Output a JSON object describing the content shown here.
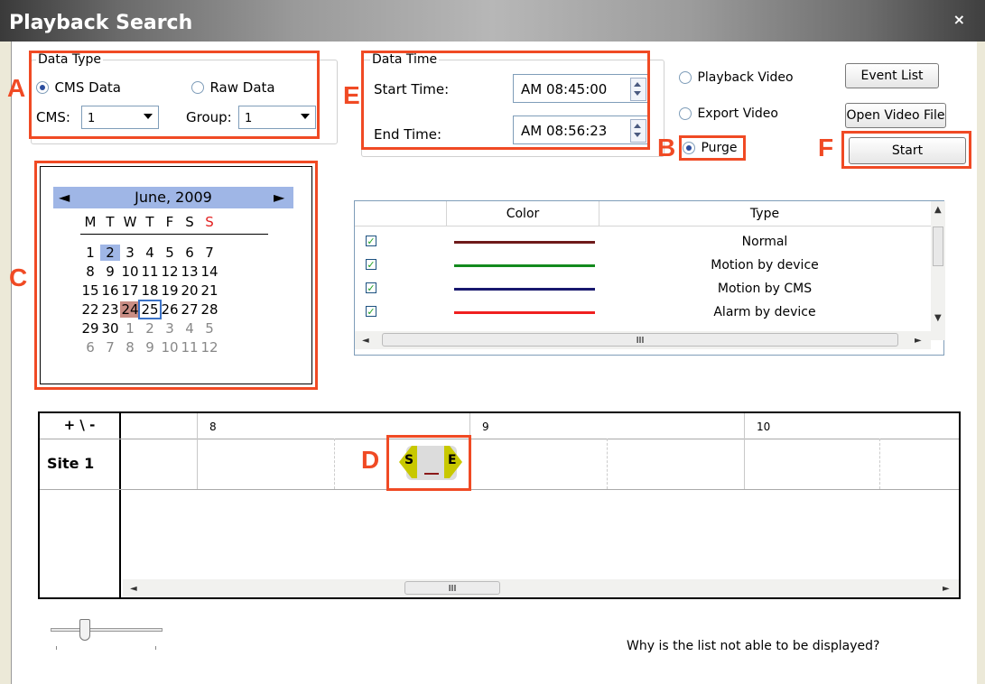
{
  "window": {
    "title": "Playback Search",
    "close": "×"
  },
  "data_type": {
    "legend": "Data Type",
    "cms_data": "CMS Data",
    "raw_data": "Raw Data",
    "cms_label": "CMS:",
    "cms_value": "1",
    "group_label": "Group:",
    "group_value": "1"
  },
  "data_time": {
    "legend": "Data Time",
    "start_label": "Start Time:",
    "start_value": "AM 08:45:00",
    "end_label": "End Time:",
    "end_value": "AM 08:56:23"
  },
  "mode": {
    "playback": "Playback Video",
    "export": "Export Video",
    "purge": "Purge"
  },
  "buttons": {
    "event_list": "Event List",
    "open_video": "Open Video File",
    "start": "Start"
  },
  "calendar": {
    "month": "June, 2009",
    "prev": "◄",
    "next": "►",
    "weekdays": [
      "M",
      "T",
      "W",
      "T",
      "F",
      "S",
      "S"
    ],
    "weeks": [
      [
        "1",
        "2",
        "3",
        "4",
        "5",
        "6",
        "7"
      ],
      [
        "8",
        "9",
        "10",
        "11",
        "12",
        "13",
        "14"
      ],
      [
        "15",
        "16",
        "17",
        "18",
        "19",
        "20",
        "21"
      ],
      [
        "22",
        "23",
        "24",
        "25",
        "26",
        "27",
        "28"
      ],
      [
        "29",
        "30",
        "1",
        "2",
        "3",
        "4",
        "5"
      ],
      [
        "6",
        "7",
        "8",
        "9",
        "10",
        "11",
        "12"
      ]
    ]
  },
  "event_table": {
    "headers": [
      "Color",
      "Type"
    ],
    "rows": [
      {
        "color": "#6e1a1a",
        "type": "Normal"
      },
      {
        "color": "#138a1d",
        "type": "Motion by device"
      },
      {
        "color": "#18186e",
        "type": "Motion by CMS"
      },
      {
        "color": "#f02020",
        "type": "Alarm by device"
      }
    ],
    "hscroll_grip": "III"
  },
  "timeline": {
    "zoom": "+ \\ -",
    "hours": [
      "8",
      "9",
      "10"
    ],
    "site": "Site 1",
    "marker_start": "S",
    "marker_end": "E",
    "hscroll_grip": "III"
  },
  "help_text": "Why is the list not able to be displayed?",
  "annotations": {
    "A": "A",
    "B": "B",
    "C": "C",
    "D": "D",
    "E": "E",
    "F": "F"
  },
  "colors": {
    "annotation": "#f04a24",
    "highlight": "#9fb6e6",
    "sunday": "#e22020"
  }
}
